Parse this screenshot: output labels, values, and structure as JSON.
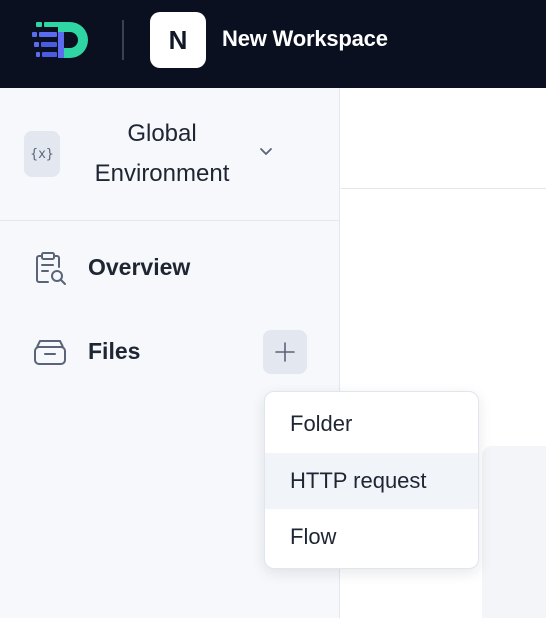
{
  "app": {
    "logo_icon": "devtools-logo-icon",
    "workspace_initial": "N",
    "workspace_name": "New Workspace"
  },
  "sidebar": {
    "environment": {
      "icon": "variable-braces-icon",
      "icon_text": "{x}",
      "label": "Global Environment",
      "chevron_icon": "chevron-down-icon"
    },
    "items": [
      {
        "label": "Overview",
        "icon": "clipboard-search-icon"
      },
      {
        "label": "Files",
        "icon": "folder-drawer-icon",
        "action_icon": "plus-icon"
      }
    ]
  },
  "add_menu": {
    "items": [
      {
        "label": "Folder",
        "highlighted": false
      },
      {
        "label": "HTTP request",
        "highlighted": true
      },
      {
        "label": "Flow",
        "highlighted": false
      }
    ]
  },
  "colors": {
    "topbar": "#0b1020",
    "logo_teal": "#2fd6a4",
    "logo_blue": "#5b6cf0",
    "sidebar_bg": "#f6f8fb",
    "highlight": "#f1f4f8"
  }
}
